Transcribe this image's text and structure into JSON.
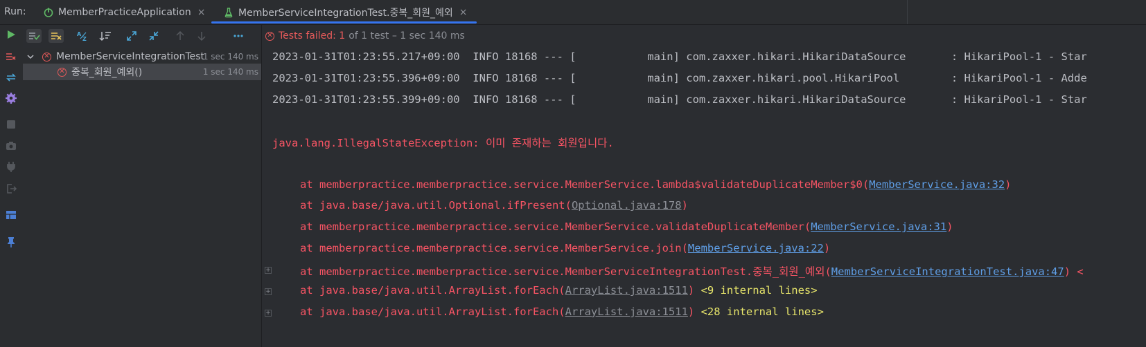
{
  "run_label": "Run:",
  "tabs": [
    {
      "label": "MemberPracticeApplication",
      "icon": "spring-boot-icon",
      "close": "×"
    },
    {
      "label": "MemberServiceIntegrationTest.중복_회원_예외",
      "icon": "test-flask-icon",
      "close": "×",
      "active": true
    }
  ],
  "status": {
    "failed": "Tests failed: 1",
    "rest": "of 1 test – 1 sec 140 ms"
  },
  "tree": [
    {
      "label": "MemberServiceIntegrationTest",
      "duration": "1 sec 140 ms",
      "state": "failed",
      "expanded": true
    },
    {
      "label": "중복_회원_예외()",
      "duration": "1 sec 140 ms",
      "state": "failed",
      "selected": true
    }
  ],
  "console": {
    "info_lines": [
      "2023-01-31T01:23:55.217+09:00  INFO 18168 --- [           main] com.zaxxer.hikari.HikariDataSource       : HikariPool-1 - Star",
      "2023-01-31T01:23:55.396+09:00  INFO 18168 --- [           main] com.zaxxer.hikari.pool.HikariPool        : HikariPool-1 - Adde",
      "2023-01-31T01:23:55.399+09:00  INFO 18168 --- [           main] com.zaxxer.hikari.HikariDataSource       : HikariPool-1 - Star"
    ],
    "exception": "java.lang.IllegalStateException: 이미 존재하는 회원입니다.",
    "stack": [
      {
        "prefix": "at memberpractice.memberpractice.service.MemberService.lambda$validateDuplicateMember$0(",
        "link": "MemberService.java:32",
        "link_style": "link",
        "suffix": ")"
      },
      {
        "prefix": "at java.base/java.util.Optional.ifPresent(",
        "link": "Optional.java:178",
        "link_style": "glink",
        "suffix": ")"
      },
      {
        "prefix": "at memberpractice.memberpractice.service.MemberService.validateDuplicateMember(",
        "link": "MemberService.java:31",
        "link_style": "link",
        "suffix": ")"
      },
      {
        "prefix": "at memberpractice.memberpractice.service.MemberService.join(",
        "link": "MemberService.java:22",
        "link_style": "link",
        "suffix": ")"
      },
      {
        "prefix": "at memberpractice.memberpractice.service.MemberServiceIntegrationTest.중복_회원_예외(",
        "link": "MemberServiceIntegrationTest.java:47",
        "link_style": "link",
        "suffix": ") <",
        "fold": "+"
      },
      {
        "prefix": "at java.base/java.util.ArrayList.forEach(",
        "link": "ArrayList.java:1511",
        "link_style": "glink",
        "suffix": ") ",
        "internal": "<9 internal lines>",
        "fold": "+"
      },
      {
        "prefix": "at java.base/java.util.ArrayList.forEach(",
        "link": "ArrayList.java:1511",
        "link_style": "glink",
        "suffix": ") ",
        "internal": "<28 internal lines>",
        "fold": "+"
      }
    ]
  },
  "toolbar_icons": [
    "rerun-icon",
    "show-passed-icon",
    "show-ignored-icon",
    "sort-alpha-icon",
    "sort-duration-icon",
    "expand-all-icon",
    "collapse-all-icon",
    "prev-failed-icon",
    "next-failed-icon",
    "more-icon"
  ],
  "left_icons": [
    "rerun-failed-icon",
    "toggle-autotest-icon",
    "settings-icon",
    "stop-icon",
    "camera-icon",
    "plug-icon",
    "exit-icon",
    "layout-icon",
    "pin-icon"
  ],
  "colors": {
    "accent": "#3574f0",
    "error": "#f75464",
    "link": "#5f9ee6",
    "internal": "#e8e66b",
    "run_green": "#5fb865"
  }
}
